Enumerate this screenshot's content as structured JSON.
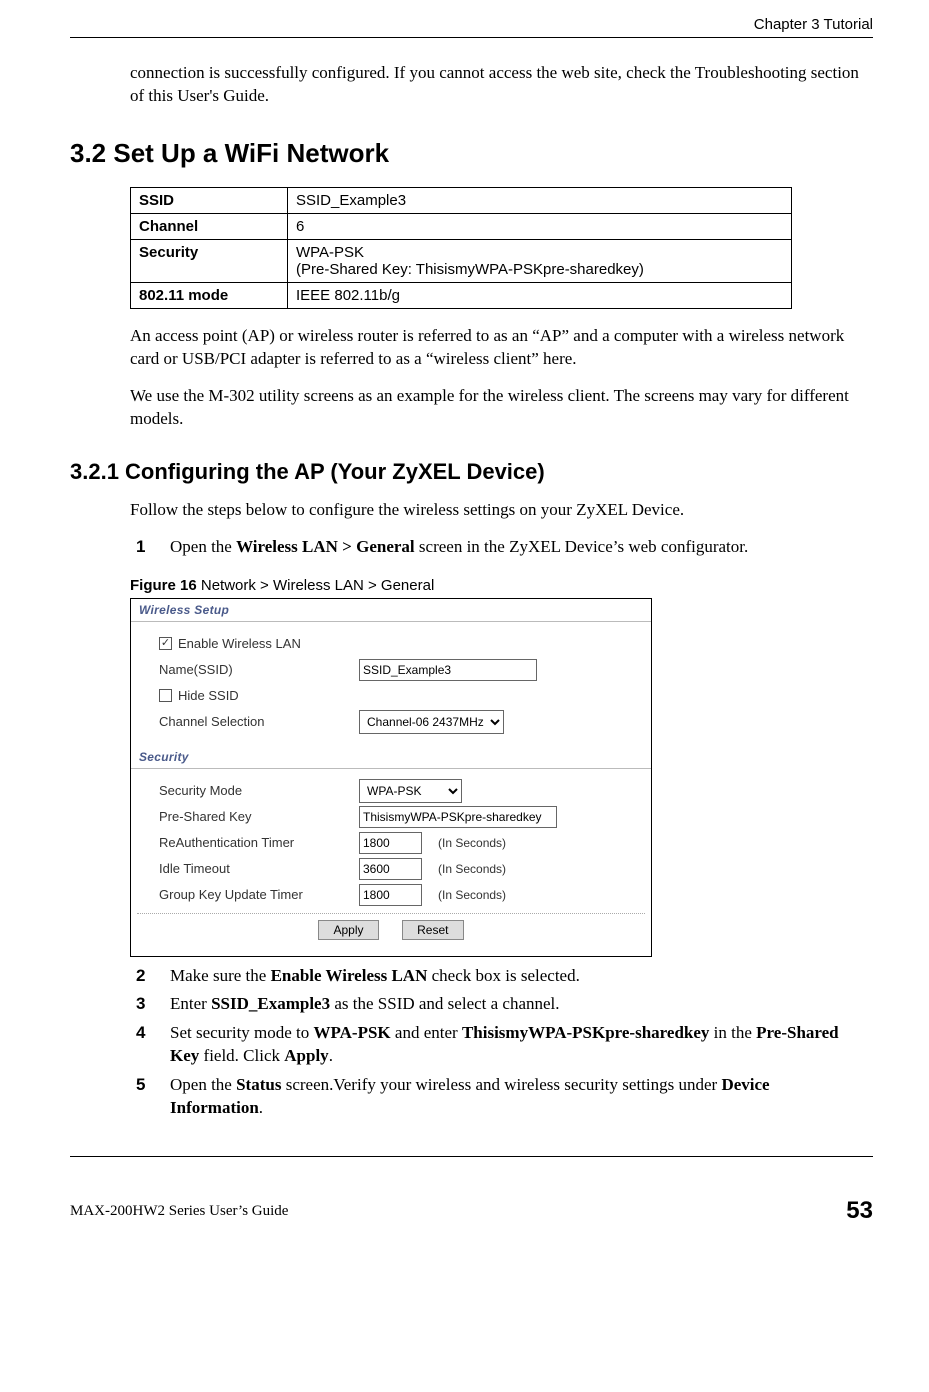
{
  "header": {
    "chapter": "Chapter 3 Tutorial"
  },
  "intro": {
    "para": "connection is successfully configured. If you cannot access the web site, check the Troubleshooting section of this User's Guide."
  },
  "section": {
    "number": "3.2",
    "title": "Set Up a WiFi Network",
    "full": "3.2  Set Up a WiFi Network"
  },
  "table": {
    "rows": [
      {
        "label": "SSID",
        "value": "SSID_Example3"
      },
      {
        "label": "Channel",
        "value": "6"
      },
      {
        "label": "Security",
        "value": "WPA-PSK\n(Pre-Shared Key: ThisismyWPA-PSKpre-sharedkey)"
      },
      {
        "label": "802.11 mode",
        "value": "IEEE 802.11b/g"
      }
    ]
  },
  "after_table": {
    "p1": "An access point (AP) or wireless router is referred to as an “AP” and a computer with a wireless network card or USB/PCI adapter is referred to as a “wireless client” here.",
    "p2": "We use the M-302 utility screens as an example for the wireless client. The screens may vary for different models."
  },
  "subsection": {
    "full": "3.2.1  Configuring the AP (Your ZyXEL Device)",
    "lead": "Follow the steps below to configure the wireless settings on your ZyXEL Device."
  },
  "step1": {
    "num": "1",
    "text_before": "Open the ",
    "bold": "Wireless LAN > General",
    "text_after": " screen in the ZyXEL Device’s web configurator."
  },
  "figure": {
    "caption_label": "Figure 16",
    "caption_rest": "   Network > Wireless LAN > General",
    "wireless_setup_header": "Wireless Setup",
    "security_header": "Security",
    "enable_wlan_label": "Enable Wireless LAN",
    "enable_wlan_checked": "✓",
    "ssid_label": "Name(SSID)",
    "ssid_value": "SSID_Example3",
    "hide_ssid_label": "Hide SSID",
    "channel_label": "Channel Selection",
    "channel_value": "Channel-06 2437MHz",
    "sec_mode_label": "Security Mode",
    "sec_mode_value": "WPA-PSK",
    "psk_label": "Pre-Shared Key",
    "psk_value": "ThisismyWPA-PSKpre-sharedkey",
    "reauth_label": "ReAuthentication Timer",
    "reauth_value": "1800",
    "idle_label": "Idle Timeout",
    "idle_value": "3600",
    "gku_label": "Group Key Update Timer",
    "gku_value": "1800",
    "in_seconds": "(In Seconds)",
    "apply": "Apply",
    "reset": "Reset"
  },
  "steps_rest": [
    {
      "num": "2",
      "html": "Make sure the <b>Enable Wireless LAN</b> check box is selected."
    },
    {
      "num": "3",
      "html": "Enter <b>SSID_Example3</b> as the SSID and select a channel."
    },
    {
      "num": "4",
      "html": "Set security mode to <b>WPA-PSK</b> and enter <b>ThisismyWPA-PSKpre-sharedkey</b> in the <b>Pre-Shared Key</b> field. Click <b>Apply</b>."
    },
    {
      "num": "5",
      "html": "Open the <b>Status</b> screen.Verify your wireless and wireless security settings under <b>Device Information</b>."
    }
  ],
  "footer": {
    "guide": "MAX-200HW2 Series User’s Guide",
    "page": "53"
  }
}
